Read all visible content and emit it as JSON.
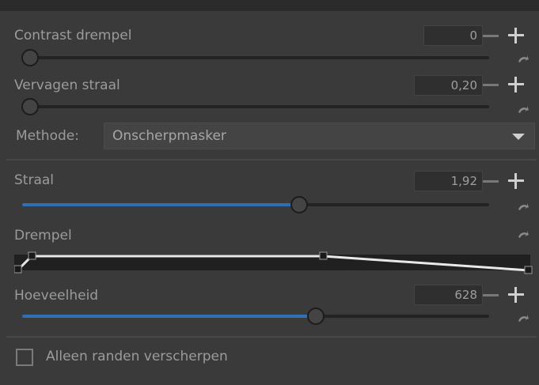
{
  "contrast_threshold": {
    "label": "Contrast drempel",
    "value": "0",
    "slider": 0.0
  },
  "fade_radius": {
    "label": "Vervagen straal",
    "value": "0,20",
    "slider": 0.0
  },
  "method": {
    "label": "Methode:",
    "selected": "Onscherpmasker"
  },
  "radius": {
    "label": "Straal",
    "value": "1,92",
    "slider": 0.59
  },
  "threshold": {
    "label": "Drempel"
  },
  "amount": {
    "label": "Hoeveelheid",
    "value": "628",
    "slider": 0.63
  },
  "edges_only": {
    "label": "Alleen randen verscherpen",
    "checked": false
  },
  "colors": {
    "accent": "#2f6fb4",
    "background": "#3a3a3a"
  },
  "icons": [
    "minus-icon",
    "plus-icon",
    "reset-icon",
    "chevron-down-icon"
  ]
}
